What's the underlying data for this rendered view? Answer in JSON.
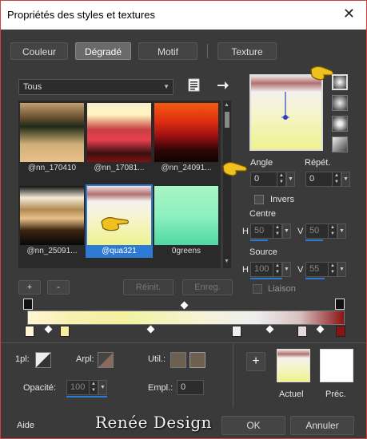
{
  "window": {
    "title": "Propriétés des styles et textures",
    "close_glyph": "✕"
  },
  "tabs": [
    {
      "label": "Couleur",
      "active": false
    },
    {
      "label": "Dégradé",
      "active": true
    },
    {
      "label": "Motif",
      "active": false
    },
    {
      "label": "Texture",
      "active": false
    }
  ],
  "category_select": {
    "value": "Tous"
  },
  "gradients": [
    {
      "label": "@nn_170410"
    },
    {
      "label": "@nn_17081..."
    },
    {
      "label": "@nn_24091..."
    },
    {
      "label": "@nn_25091..."
    },
    {
      "label": "@qua321",
      "selected": true
    },
    {
      "label": "0greens"
    }
  ],
  "list_buttons": {
    "add": "+",
    "remove": "-",
    "reset": "Réinit.",
    "save": "Enreg."
  },
  "angle": {
    "label": "Angle",
    "value": "0"
  },
  "repeat": {
    "label": "Répét.",
    "value": "0"
  },
  "invert": {
    "label": "Invers"
  },
  "center": {
    "label": "Centre",
    "h_label": "H",
    "h_value": "50",
    "v_label": "V",
    "v_value": "50"
  },
  "source": {
    "label": "Source",
    "h_label": "H",
    "h_value": "100",
    "v_label": "V",
    "v_value": "55"
  },
  "link": {
    "label": "Liaison"
  },
  "stop_controls": {
    "first_label": "1pl:",
    "back_label": "Arpl:",
    "use_label": "Util.:",
    "opacity_label": "Opacité:",
    "opacity_value": "100",
    "location_label": "Empl.:",
    "location_value": "0"
  },
  "compare": {
    "current_label": "Actuel",
    "previous_label": "Préc.",
    "add_glyph": "+"
  },
  "footer": {
    "help": "Aide",
    "watermark": "Renée Design",
    "ok": "OK",
    "cancel": "Annuler"
  }
}
